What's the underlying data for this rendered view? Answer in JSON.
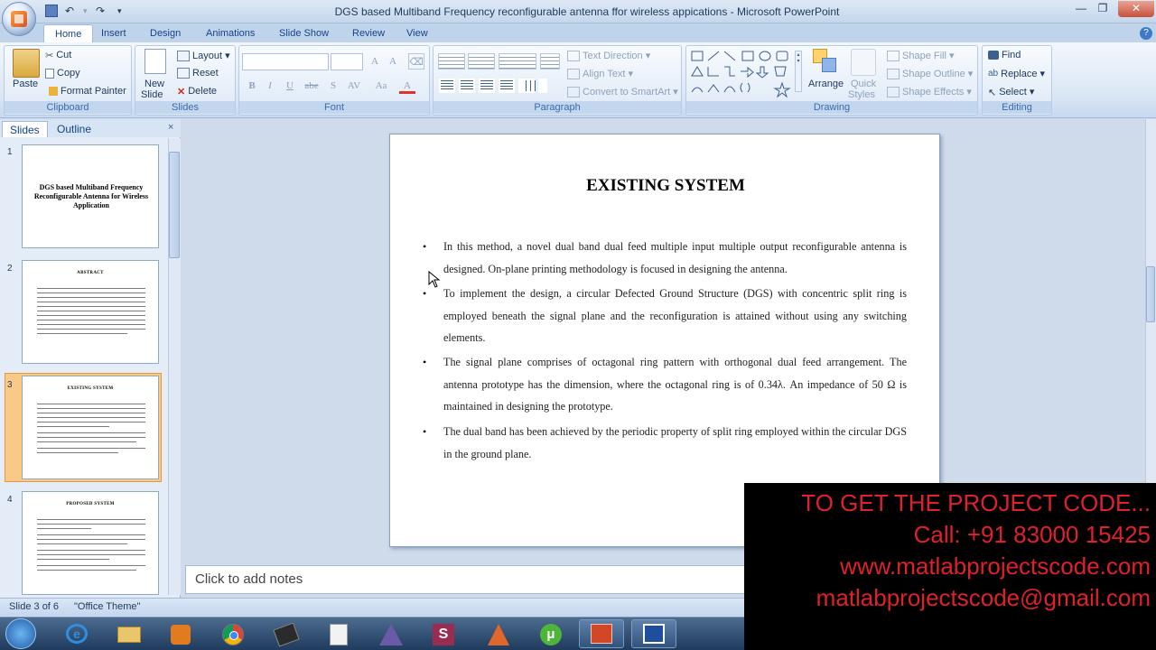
{
  "window": {
    "title": "DGS based Multiband Frequency reconfigurable antenna ffor wireless appications - Microsoft PowerPoint"
  },
  "tabs": [
    "Home",
    "Insert",
    "Design",
    "Animations",
    "Slide Show",
    "Review",
    "View"
  ],
  "ribbon": {
    "clipboard": {
      "label": "Clipboard",
      "paste": "Paste",
      "cut": "Cut",
      "copy": "Copy",
      "format_painter": "Format Painter"
    },
    "slides": {
      "label": "Slides",
      "new_slide_1": "New",
      "new_slide_2": "Slide",
      "layout": "Layout",
      "reset": "Reset",
      "delete": "Delete"
    },
    "font": {
      "label": "Font",
      "bold": "B",
      "italic": "I",
      "underline": "U",
      "strike": "abe",
      "shadow": "S",
      "spacing": "AV",
      "case": "Aa",
      "color": "A"
    },
    "paragraph": {
      "label": "Paragraph",
      "text_direction": "Text Direction",
      "align_text": "Align Text",
      "smartart": "Convert to SmartArt"
    },
    "drawing": {
      "label": "Drawing",
      "arrange": "Arrange",
      "quick_styles_1": "Quick",
      "quick_styles_2": "Styles",
      "shape_fill": "Shape Fill",
      "shape_outline": "Shape Outline",
      "shape_effects": "Shape Effects"
    },
    "editing": {
      "label": "Editing",
      "find": "Find",
      "replace": "Replace",
      "select": "Select"
    }
  },
  "left_pane": {
    "tab_slides": "Slides",
    "tab_outline": "Outline",
    "thumbnails": [
      {
        "num": "1",
        "title": "DGS based Multiband Frequency Reconfigurable Antenna for Wireless Application"
      },
      {
        "num": "2",
        "title": "ABSTRACT"
      },
      {
        "num": "3",
        "title": "EXISTING SYSTEM"
      },
      {
        "num": "4",
        "title": "PROPOSED SYSTEM"
      }
    ]
  },
  "slide": {
    "title": "EXISTING SYSTEM",
    "bullet_char": "•",
    "bullets": [
      "In this method, a novel dual band dual feed multiple input multiple output reconfigurable antenna is designed. On-plane printing methodology is focused in designing the antenna.",
      "To implement the design, a circular Defected Ground Structure (DGS) with concentric split ring is employed beneath the signal plane and the reconfiguration is attained without using any switching elements.",
      "The signal plane comprises of octagonal ring pattern with orthogonal dual feed arrangement. The antenna prototype has the dimension, where the octagonal ring is of 0.34λ. An impedance of 50 Ω is maintained in designing the prototype.",
      "The dual band has been achieved by the periodic property of split ring employed within the circular DGS in the ground plane."
    ]
  },
  "notes": {
    "placeholder": "Click to add notes"
  },
  "status": {
    "slide_info": "Slide 3 of 6",
    "theme": "\"Office Theme\""
  },
  "overlay": {
    "line1": "TO GET THE PROJECT CODE...",
    "line2": "Call: +91 83000 15425",
    "line3": "www.matlabprojectscode.com",
    "line4": "matlabprojectscode@gmail.com",
    "color": "#e0202a"
  }
}
